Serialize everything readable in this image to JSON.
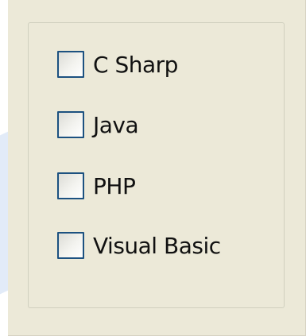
{
  "checkbox_group": {
    "options": [
      {
        "label": "C Sharp",
        "checked": false
      },
      {
        "label": "Java",
        "checked": false
      },
      {
        "label": "PHP",
        "checked": false
      },
      {
        "label": "Visual Basic",
        "checked": false
      }
    ]
  },
  "colors": {
    "window_background": "#ece9d8",
    "checkbox_border": "#1c5180",
    "text": "#111111"
  }
}
